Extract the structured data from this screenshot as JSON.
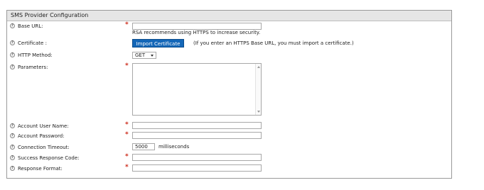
{
  "panel": {
    "title": "SMS Provider Configuration"
  },
  "help_icon_glyph": "?",
  "required_marker": "*",
  "fields": {
    "base_url": {
      "label": "Base URL:",
      "value": "",
      "hint": "RSA recommends using HTTPS to increase security."
    },
    "certificate": {
      "label": "Certificate :",
      "button_label": "Import Certificate",
      "hint": "(If you enter an HTTPS Base URL, you must import a certificate.)"
    },
    "http_method": {
      "label": "HTTP Method:",
      "value": "GET"
    },
    "parameters": {
      "label": "Parameters:",
      "value": ""
    },
    "account_user_name": {
      "label": "Account User Name:",
      "value": ""
    },
    "account_password": {
      "label": "Account Password:",
      "value": ""
    },
    "connection_timeout": {
      "label": "Connection Timeout:",
      "value": "5000",
      "unit": "milliseconds"
    },
    "success_response_code": {
      "label": "Success Response Code:",
      "value": ""
    },
    "response_format": {
      "label": "Response Format:",
      "value": ""
    }
  },
  "colors": {
    "required": "#cc2a1a",
    "button_bg": "#1467b8",
    "header_bg": "#e6e6e6",
    "border": "#9a9a9a"
  },
  "icons": {
    "help": "help-icon",
    "dropdown": "chevron-down-icon"
  }
}
